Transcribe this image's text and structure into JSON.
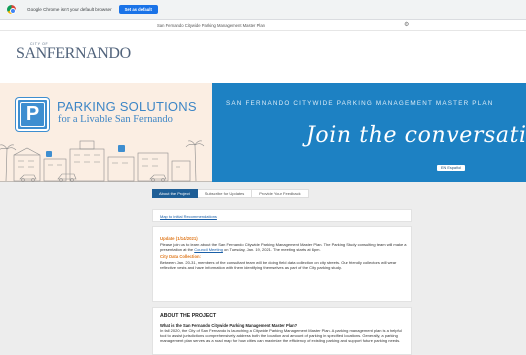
{
  "browser_bar": {
    "message": "Google Chrome isn't your default browser",
    "set_default_label": "Set as default"
  },
  "top_strip": {
    "title": "San Fernando Citywide Parking Management Master Plan",
    "gear_icon": "gear-icon"
  },
  "logo": {
    "small": "CITY OF",
    "big": "SANFERNANDO"
  },
  "banner": {
    "sign_letter": "P",
    "title": "PARKING SOLUTIONS",
    "subtitle": "for a Livable San Fernando",
    "right_title": "SAN FERNANDO CITYWIDE PARKING MANAGEMENT MASTER PLAN",
    "script": "Join the conversation",
    "badge": "EN Español"
  },
  "tabs": [
    {
      "label": "About the Project",
      "active": true
    },
    {
      "label": "Subscribe for Updates",
      "active": false
    },
    {
      "label": "Provide Your Feedback",
      "active": false
    }
  ],
  "plan_link": "Map to initial Recommendations",
  "update": {
    "heading": "Update (1/14/2021)",
    "body_before_link": "Please join us to learn about the San Fernando Citywide Parking Management Master Plan. The Parking Study consulting team will make a presentation at the ",
    "link": "Council Meeting",
    "body_after_link": " on Tuesday, Jan. 19, 2021. The meeting starts at 6pm.",
    "data_heading": "City Data Collection:",
    "data_body": "Between Jan. 20-31, members of the consultant team will be doing field data collection on city streets. Our friendly collectors will wear reflective vests and have information with them identifying themselves as part of the City parking study."
  },
  "about": {
    "heading": "ABOUT THE PROJECT",
    "question": "What is the San Fernando Citywide Parking Management Master Plan?",
    "body": "In fall 2020, the City of San Fernando is launching a Citywide Parking Management Master Plan. A parking management plan is a helpful tool to assist jurisdictions comprehensively address both the location and amount of parking in specified locations. Generally, a parking management plan serves as a road map for how cities can maximize the efficiency of existing parking and support future parking needs."
  },
  "colors": {
    "tab_active": "#1e5e96",
    "banner_blue": "#1d81c3",
    "banner_peach": "#fbeee3",
    "update_orange": "#e07a1f",
    "link_blue": "#1a5fa8",
    "chrome_button": "#1a73e8"
  }
}
